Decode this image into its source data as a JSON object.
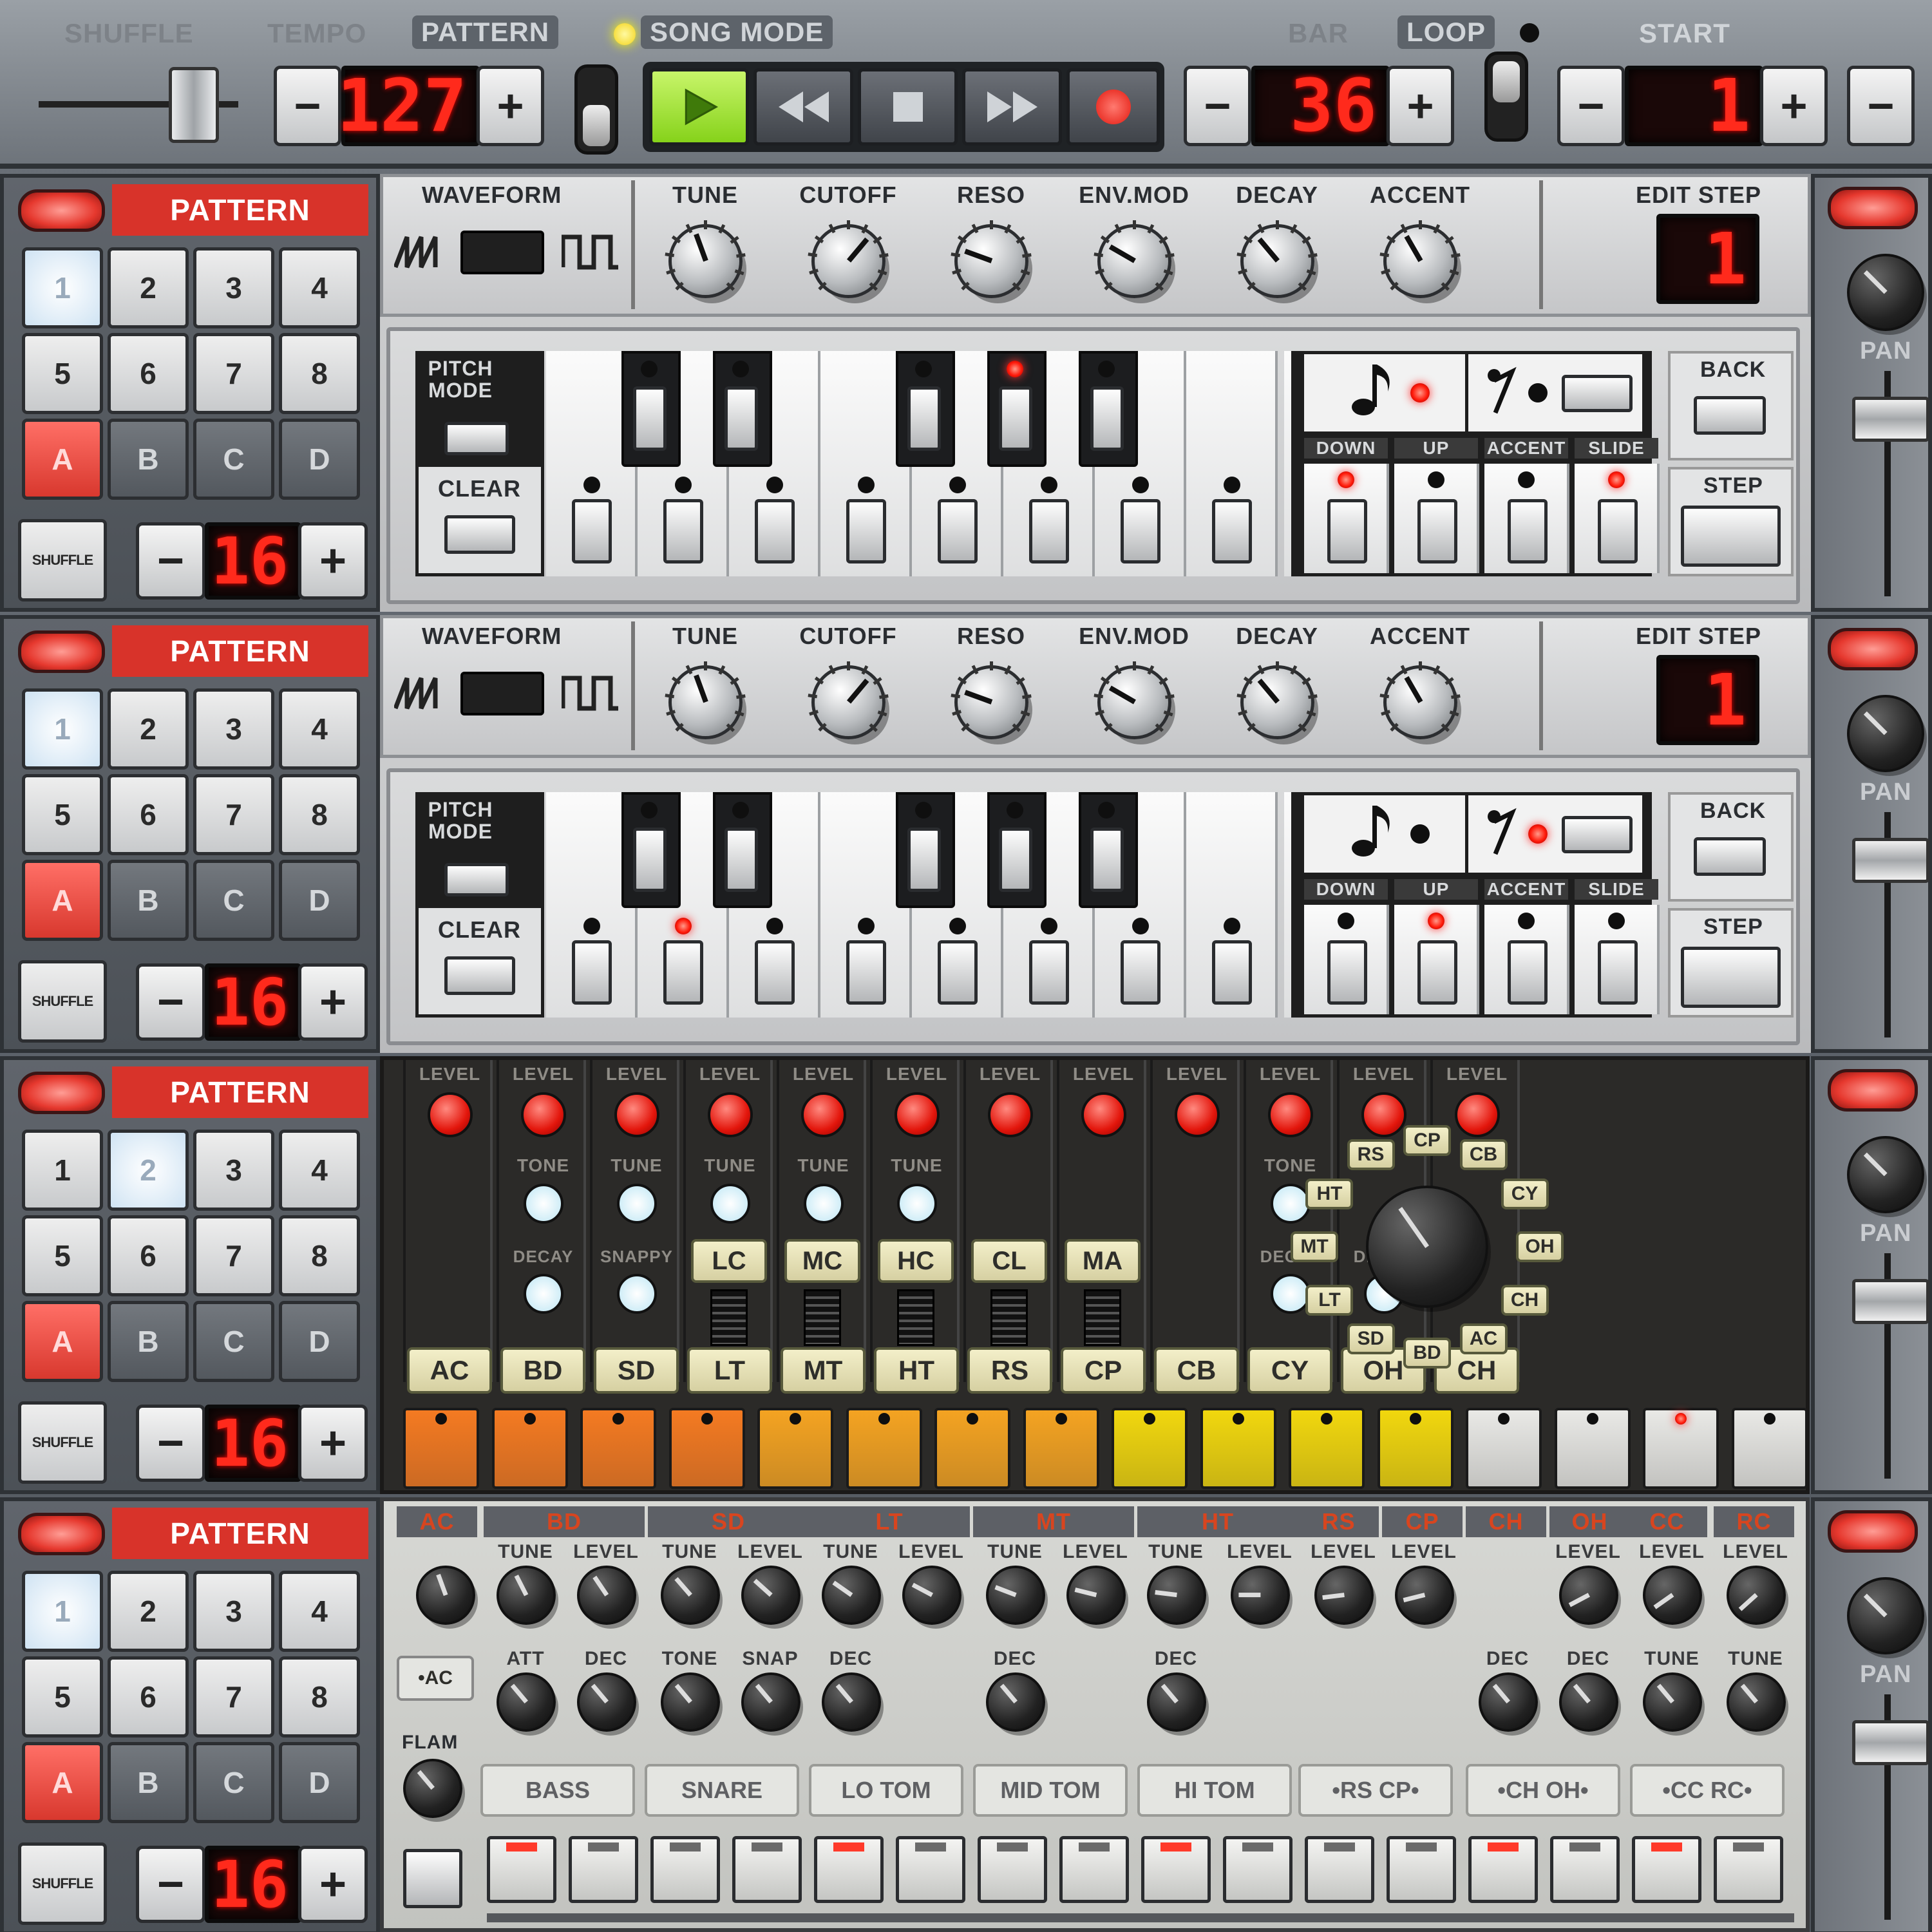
{
  "transport": {
    "labels": {
      "shuffle": "SHUFFLE",
      "tempo": "TEMPO",
      "pattern": "PATTERN",
      "song_mode": "SONG MODE",
      "bar": "BAR",
      "loop": "LOOP",
      "start": "START"
    },
    "tempo_value": "127",
    "bar_value": "36",
    "start_value": "1",
    "minus": "−",
    "plus": "+"
  },
  "rows": [
    {
      "pattern_label": "PATTERN",
      "pads": [
        "1",
        "2",
        "3",
        "4",
        "5",
        "6",
        "7",
        "8",
        "A",
        "B",
        "C",
        "D"
      ],
      "selected_num": "1",
      "selected_bank": "A",
      "shuffle_label": "SHUFFLE",
      "steps_value": "16",
      "minus": "−",
      "plus": "+",
      "pan_label": "PAN"
    },
    {
      "pattern_label": "PATTERN",
      "pads": [
        "1",
        "2",
        "3",
        "4",
        "5",
        "6",
        "7",
        "8",
        "A",
        "B",
        "C",
        "D"
      ],
      "selected_num": "1",
      "selected_bank": "A",
      "shuffle_label": "SHUFFLE",
      "steps_value": "16",
      "minus": "−",
      "plus": "+",
      "pan_label": "PAN"
    },
    {
      "pattern_label": "PATTERN",
      "pads": [
        "1",
        "2",
        "3",
        "4",
        "5",
        "6",
        "7",
        "8",
        "A",
        "B",
        "C",
        "D"
      ],
      "selected_num": "2",
      "selected_bank": "A",
      "shuffle_label": "SHUFFLE",
      "steps_value": "16",
      "minus": "−",
      "plus": "+",
      "pan_label": "PAN"
    },
    {
      "pattern_label": "PATTERN",
      "pads": [
        "1",
        "2",
        "3",
        "4",
        "5",
        "6",
        "7",
        "8",
        "A",
        "B",
        "C",
        "D"
      ],
      "selected_num": "1",
      "selected_bank": "A",
      "shuffle_label": "SHUFFLE",
      "steps_value": "16",
      "minus": "−",
      "plus": "+",
      "pan_label": "PAN"
    }
  ],
  "bassline": {
    "labels": {
      "waveform": "WAVEFORM",
      "tune": "TUNE",
      "cutoff": "CUTOFF",
      "reso": "RESO",
      "env_mod": "ENV.MOD",
      "decay": "DECAY",
      "accent": "ACCENT",
      "edit_step": "EDIT STEP",
      "pitch_mode": "PITCH MODE",
      "clear": "CLEAR",
      "back": "BACK",
      "step": "STEP",
      "down": "DOWN",
      "up": "UP",
      "accent_btn": "ACCENT",
      "slide": "SLIDE"
    },
    "edit_step_value": "1"
  },
  "drum_machine": {
    "level_label": "LEVEL",
    "tone_label": "TONE",
    "tune_label": "TUNE",
    "decay_label": "DECAY",
    "snappy_label": "SNAPPY",
    "instruments": [
      "AC",
      "BD",
      "SD",
      "LT",
      "MT",
      "HT",
      "RS",
      "CP",
      "CB",
      "CY",
      "OH",
      "CH"
    ],
    "toms": [
      "LC",
      "MC",
      "HC",
      "CL",
      "MA"
    ],
    "selector": [
      "HT",
      "RS",
      "CP",
      "CB",
      "CY",
      "OH",
      "CH",
      "AC",
      "BD",
      "SD",
      "LT",
      "MT"
    ]
  },
  "tr909": {
    "headers": [
      "AC",
      "BD",
      "SD",
      "LT",
      "MT",
      "HT",
      "RS",
      "CP",
      "CH",
      "OH",
      "CC",
      "RC"
    ],
    "level": "LEVEL",
    "tune": "TUNE",
    "att": "ATT",
    "dec": "DEC",
    "tone": "TONE",
    "snap": "SNAP",
    "flam": "FLAM",
    "ac_btn": "•AC",
    "inst_buttons": [
      "BASS",
      "SNARE",
      "LO TOM",
      "MID TOM",
      "HI TOM",
      "•RS  CP•",
      "•CH  OH•",
      "•CC  RC•"
    ]
  },
  "colors": {
    "lcd_red": "#ff2a1c",
    "play_green": "#9be02a",
    "pattern_red": "#d8332a"
  }
}
